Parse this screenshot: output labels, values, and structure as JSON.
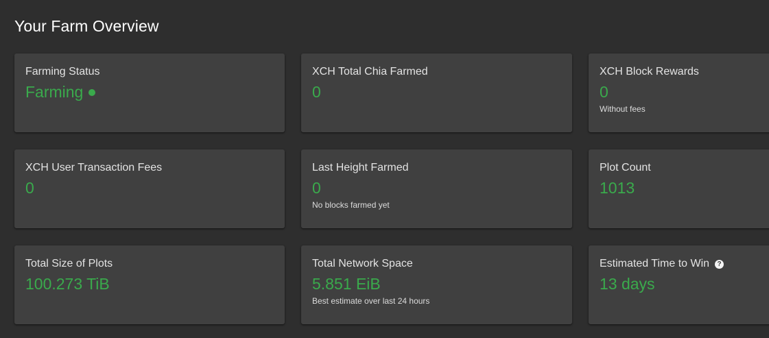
{
  "page": {
    "title": "Your Farm Overview"
  },
  "cards": [
    {
      "title": "Farming Status",
      "value": "Farming",
      "status_indicator": "green-dot"
    },
    {
      "title": "XCH Total Chia Farmed",
      "value": "0"
    },
    {
      "title": "XCH Block Rewards",
      "value": "0",
      "caption": "Without fees"
    },
    {
      "title": "XCH User Transaction Fees",
      "value": "0"
    },
    {
      "title": "Last Height Farmed",
      "value": "0",
      "caption": "No blocks farmed yet"
    },
    {
      "title": "Plot Count",
      "value": "1013"
    },
    {
      "title": "Total Size of Plots",
      "value": "100.273 TiB"
    },
    {
      "title": "Total Network Space",
      "value": "5.851 EiB",
      "caption": "Best estimate over last 24 hours"
    },
    {
      "title": "Estimated Time to Win",
      "value": "13 days",
      "help_icon": "?"
    }
  ],
  "colors": {
    "background": "#2e2e2e",
    "card": "#404040",
    "accent_green": "#3aaa4c"
  }
}
